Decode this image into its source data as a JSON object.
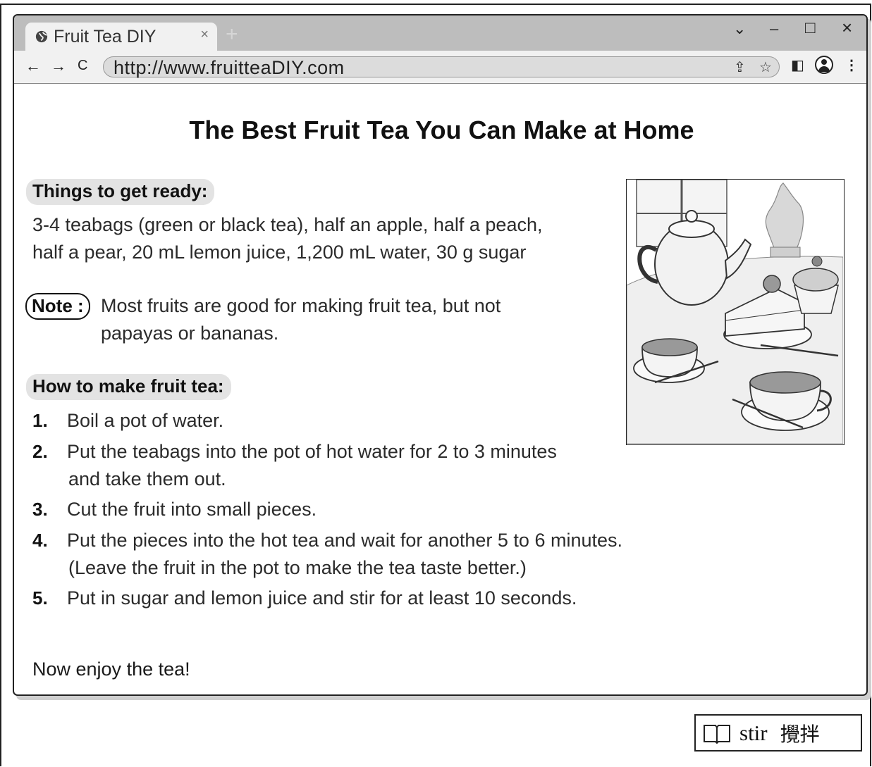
{
  "browser": {
    "tab_title": "Fruit Tea DIY",
    "tab_close": "×",
    "new_tab": "+",
    "url": "http://www.fruitteaDIY.com",
    "window_controls": {
      "dropdown": "⌄",
      "minimize": "–",
      "maximize": "□",
      "close": "×"
    },
    "nav": {
      "back": "←",
      "forward": "→",
      "reload": "C"
    },
    "icons": [
      "globe-icon",
      "share-icon",
      "star-icon",
      "side-panel-icon",
      "profile-icon",
      "menu-icon"
    ]
  },
  "page": {
    "title": "The Best Fruit Tea You Can Make at Home",
    "ingredients_heading": "Things to get ready:",
    "ingredients_line1": "3-4 teabags (green or black tea), half an apple, half a peach,",
    "ingredients_line2": "half a pear, 20 mL lemon juice, 1,200 mL water, 30 g sugar",
    "note_label": "Note :",
    "note_line1": "Most fruits are good for making fruit tea, but not",
    "note_line2": "papayas or bananas.",
    "steps_heading": "How to make fruit tea:",
    "steps": [
      {
        "num": "1.",
        "line1": "Boil a pot of water.",
        "line2": ""
      },
      {
        "num": "2.",
        "line1": "Put the teabags into the pot of hot water for 2 to 3 minutes",
        "line2": "and take them out."
      },
      {
        "num": "3.",
        "line1": "Cut the fruit into small pieces.",
        "line2": ""
      },
      {
        "num": "4.",
        "line1": "Put the pieces into the hot tea and wait for another 5 to 6 minutes.",
        "line2": "(Leave the fruit in the pot to make the tea taste better.)"
      },
      {
        "num": "5.",
        "line1": "Put in sugar and lemon juice and stir for at least 10 seconds.",
        "line2": ""
      }
    ],
    "closing": "Now enjoy the tea!"
  },
  "glossary": {
    "word": "stir",
    "definition": "攪拌",
    "icon": "book-icon"
  },
  "colors": {
    "chrome_bg": "#bdbdbd",
    "toolbar_bg": "#f1f1f1",
    "pill_bg": "#e3e3e3"
  }
}
